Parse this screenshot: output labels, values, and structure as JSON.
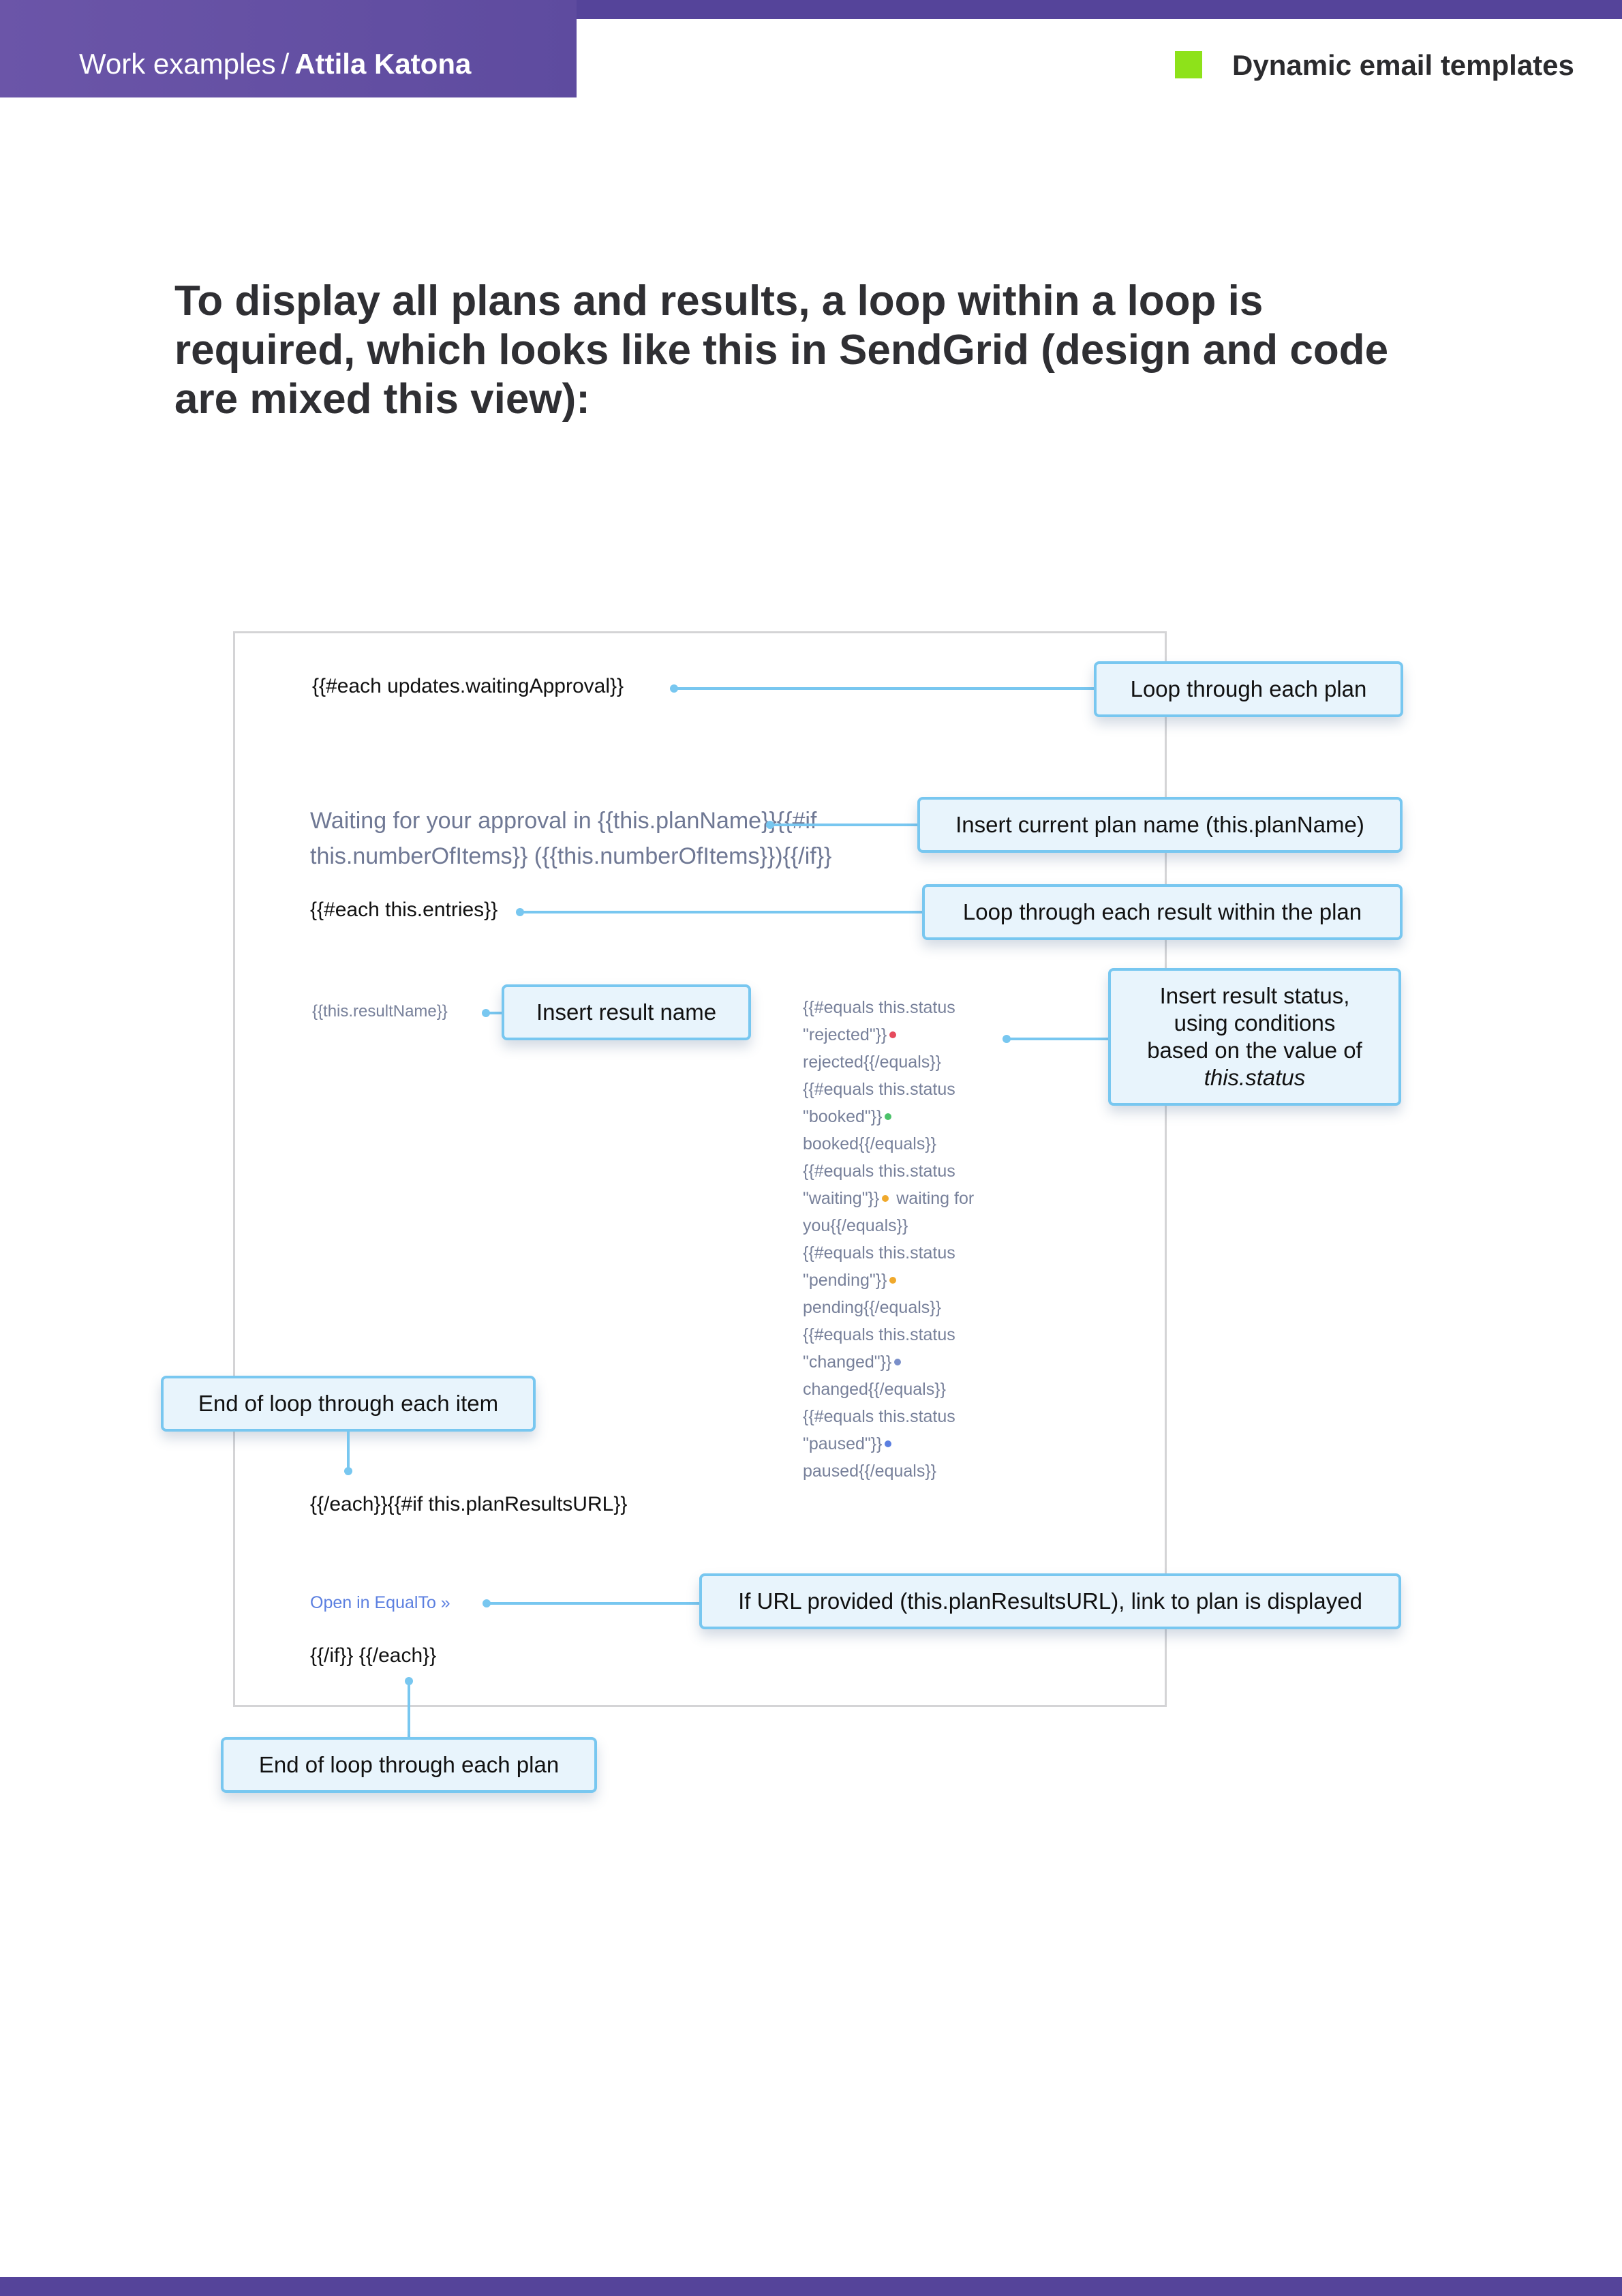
{
  "header": {
    "section": "Work examples",
    "separator": "/",
    "author": "Attila Katona",
    "topic": "Dynamic email templates",
    "accent_color": "#8ee21a",
    "brand_color": "#5e4b9f"
  },
  "heading": "To display all plans and results, a loop within a loop is required, which looks like this in SendGrid (design and code are mixed this view):",
  "template": {
    "each_waiting": "{{#each updates.waitingApproval}}",
    "plan_line": "Waiting for your approval in {{this.planName}}{{#if this.numberOfItems}} ({{this.numberOfItems}}){{/if}}",
    "each_entries": "{{#each this.entries}}",
    "result_name": "{{this.resultName}}",
    "statuses": [
      {
        "code": "{{#equals this.status \"rejected\"}}",
        "label": "rejected{{/equals}}",
        "color": "#e64b5d"
      },
      {
        "code": "{{#equals this.status \"booked\"}}",
        "label": "booked{{/equals}}",
        "color": "#4cc26a"
      },
      {
        "code": "{{#equals this.status \"waiting\"}}",
        "label": "waiting for you{{/equals}}",
        "color": "#f0a92c"
      },
      {
        "code": "{{#equals this.status \"pending\"}}",
        "label": "pending{{/equals}}",
        "color": "#f0a92c"
      },
      {
        "code": "{{#equals this.status \"changed\"}}",
        "label": "changed{{/equals}}",
        "color": "#7a8fc9"
      },
      {
        "code": "{{#equals this.status \"paused\"}}",
        "label": "paused{{/equals}}",
        "color": "#5b7fe0"
      }
    ],
    "end_each_if": "{{/each}}{{#if this.planResultsURL}}",
    "link_text": "Open in EqualTo »",
    "end_if_each": "{{/if}} {{/each}}"
  },
  "callouts": {
    "loop_plan": "Loop through each plan",
    "insert_plan_name": "Insert current plan name (this.planName)",
    "loop_result": "Loop through each result within the plan",
    "insert_result_name": "Insert result name",
    "status_line1": "Insert result status,",
    "status_line2": "using conditions",
    "status_line3": "based on the value of",
    "status_var": "this.status",
    "end_item": "End of loop through each item",
    "url_provided": "If URL provided (this.planResultsURL), link to plan is displayed",
    "end_plan": "End of loop through each plan"
  }
}
